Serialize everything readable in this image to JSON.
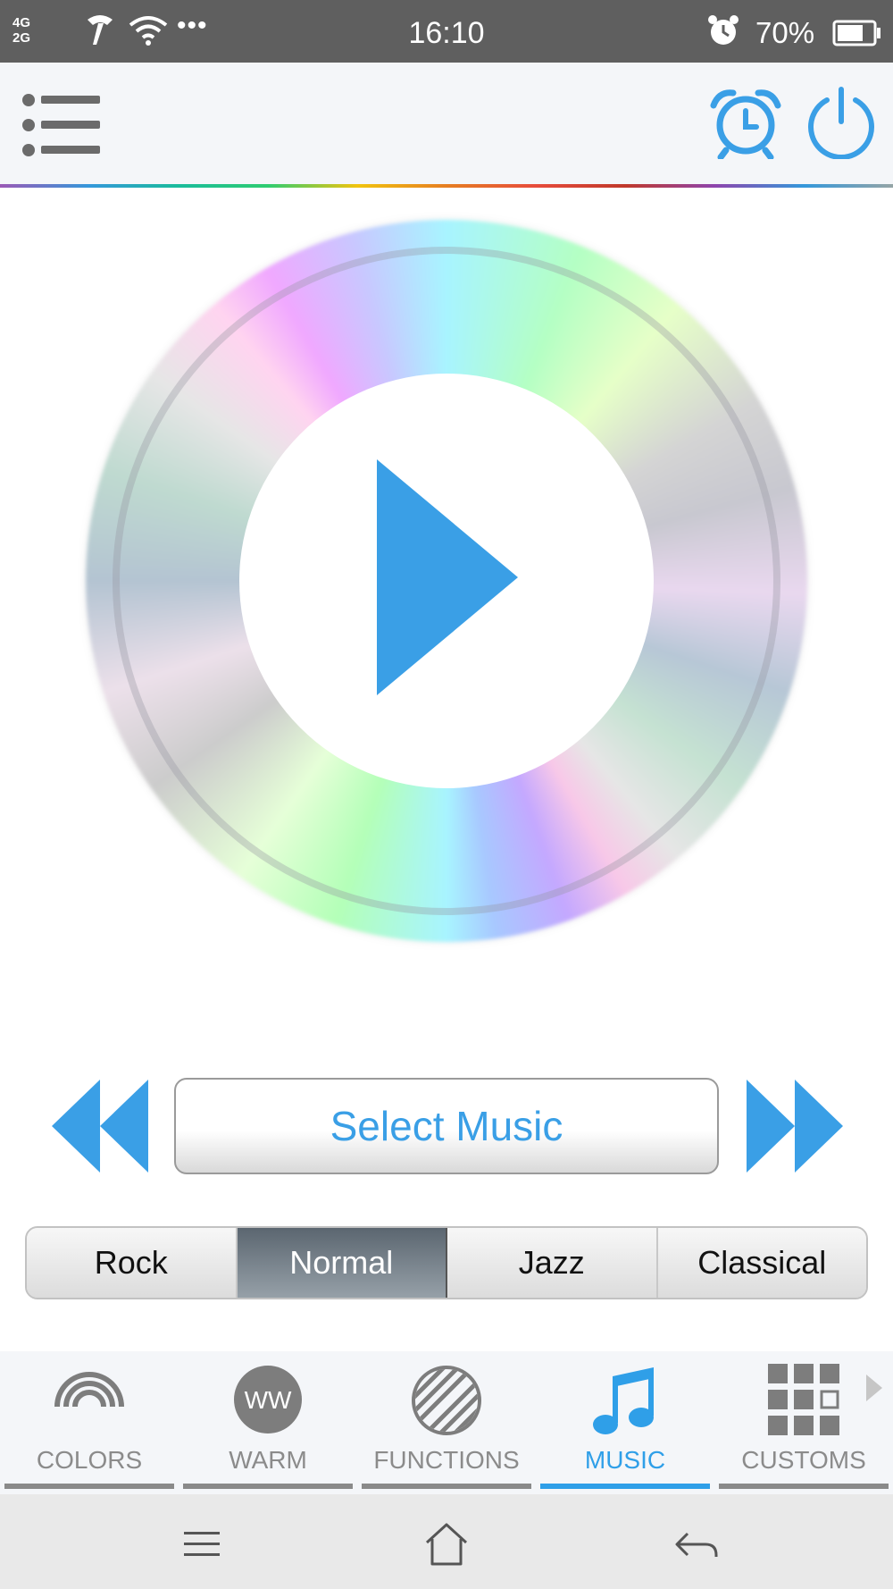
{
  "status_bar": {
    "network_top": "4G",
    "network_bottom": "2G",
    "time": "16:10",
    "battery": "70%",
    "icons": [
      "carrier-icon",
      "wifi-icon",
      "more-dots-icon",
      "alarm-icon",
      "battery-icon"
    ]
  },
  "app_bar": {
    "icons": [
      "menu-list-icon",
      "alarm-clock-icon",
      "power-icon"
    ],
    "accent_color": "#3a9fe6"
  },
  "player": {
    "play_icon": "play-icon",
    "prev_icon": "rewind-icon",
    "next_icon": "fast-forward-icon",
    "select_label": "Select Music"
  },
  "genres": {
    "items": [
      "Rock",
      "Normal",
      "Jazz",
      "Classical"
    ],
    "selected": "Normal"
  },
  "tabs": {
    "items": [
      {
        "label": "COLORS",
        "icon": "rainbow-icon"
      },
      {
        "label": "WARM",
        "icon": "ww-icon",
        "icon_text": "WW"
      },
      {
        "label": "FUNCTIONS",
        "icon": "striped-circle-icon"
      },
      {
        "label": "MUSIC",
        "icon": "music-note-icon"
      },
      {
        "label": "CUSTOMS",
        "icon": "grid-icon"
      }
    ],
    "active": "MUSIC",
    "more_icon": "chevron-right-icon"
  },
  "nav_bar": {
    "icons": [
      "menu-icon",
      "home-icon",
      "back-icon"
    ]
  }
}
